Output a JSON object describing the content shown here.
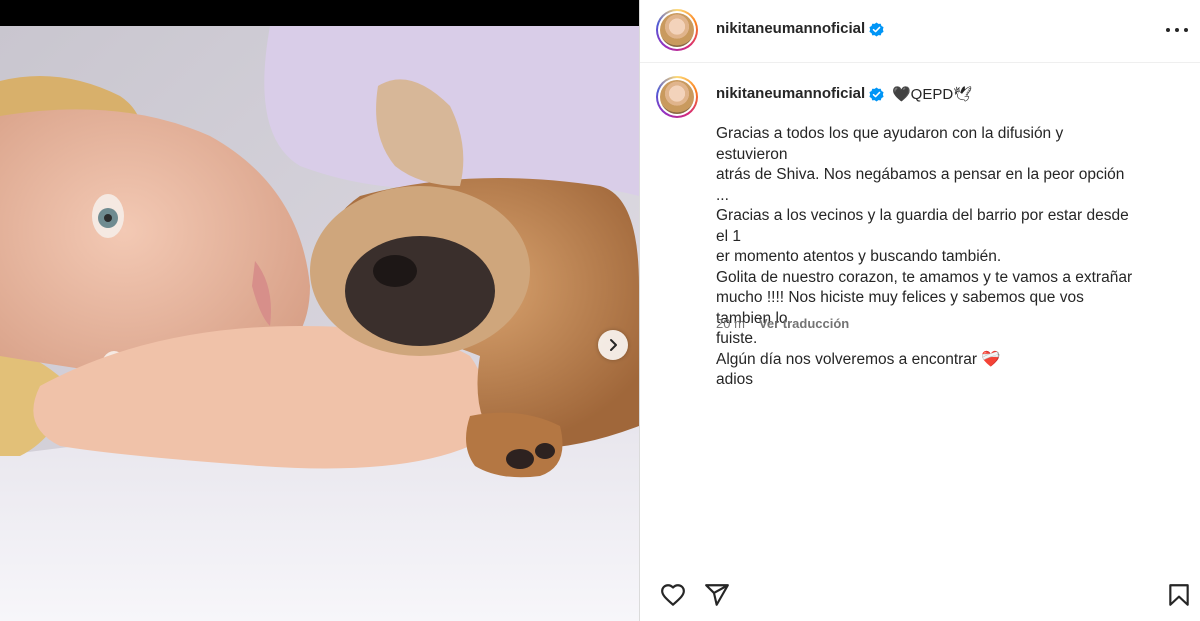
{
  "post": {
    "username": "nikitaneumannoficial",
    "caption_title": "🖤QEPD🕊",
    "caption_lines": [
      "Gracias a todos los que ayudaron con la difusión y estuvieron",
      "atrás de Shiva. Nos negábamos a pensar en la peor opción ...",
      "Gracias a los vecinos y la guardia del barrio por estar desde el 1",
      "er momento atentos y buscando también.",
      "Golita de nuestro corazon, te amamos y te vamos a extrañar",
      "mucho !!!! Nos hiciste muy felices y sabemos que vos tambien lo",
      "fuiste.",
      "Algún día nos volveremos a encontrar ❤️‍🩹",
      "adios"
    ],
    "time_ago": "20 m",
    "translate_label": "Ver traducción"
  },
  "icons": {
    "verified": "verified-badge-icon",
    "more": "more-options-icon",
    "next": "chevron-right-icon",
    "like": "heart-icon",
    "share": "share-icon",
    "save": "bookmark-icon"
  },
  "colors": {
    "verified": "#0095f6",
    "text": "#262626",
    "secondary": "#737373"
  }
}
